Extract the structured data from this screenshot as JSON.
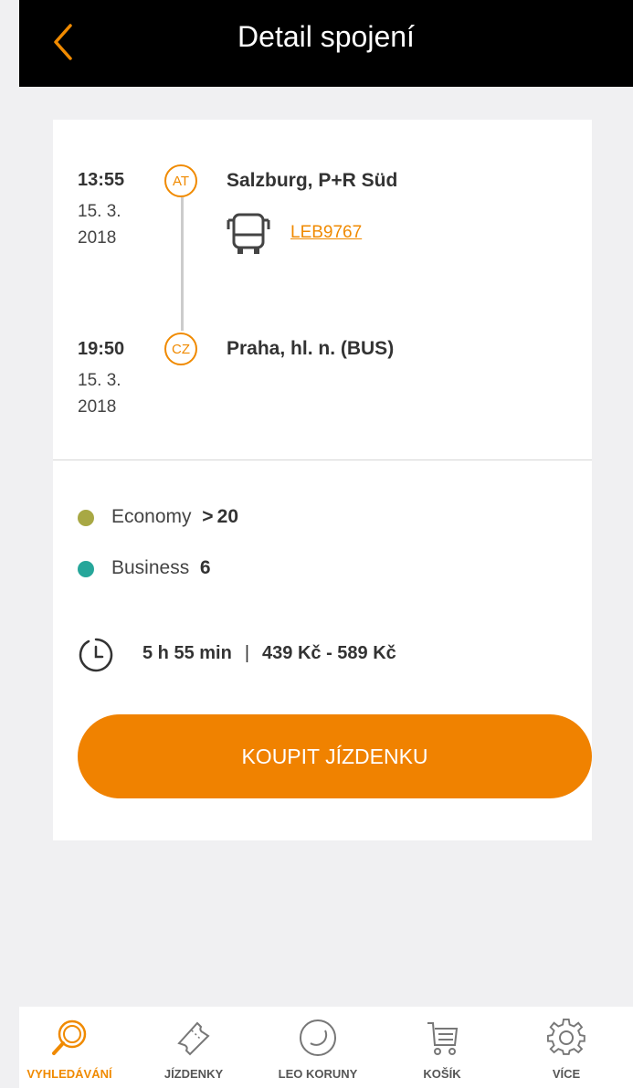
{
  "header": {
    "title": "Detail spojení"
  },
  "trip": {
    "departure": {
      "time": "13:55",
      "date": "15. 3. 2018",
      "country": "AT",
      "stop": "Salzburg, P+R Süd"
    },
    "line": "LEB9767",
    "arrival": {
      "time": "19:50",
      "date": "15. 3. 2018",
      "country": "CZ",
      "stop": "Praha, hl. n. (BUS)"
    }
  },
  "classes": [
    {
      "name": "Economy",
      "seats": "> 20",
      "color": "#a8a844"
    },
    {
      "name": "Business",
      "seats": "6",
      "color": "#26a69a"
    }
  ],
  "summary": {
    "duration": "5 h 55 min",
    "separator": "|",
    "price": "439 Kč - 589 Kč"
  },
  "buy_label": "KOUPIT JÍZDENKU",
  "tabs": [
    {
      "label": "VYHLEDÁVÁNÍ",
      "icon": "search-icon"
    },
    {
      "label": "JÍZDENKY",
      "icon": "ticket-icon"
    },
    {
      "label": "LEO KORUNY",
      "icon": "coin-icon"
    },
    {
      "label": "KOŠÍK",
      "icon": "cart-icon"
    },
    {
      "label": "VÍCE",
      "icon": "gear-icon"
    }
  ],
  "colors": {
    "accent": "#f08200",
    "header_bg": "#000000"
  }
}
